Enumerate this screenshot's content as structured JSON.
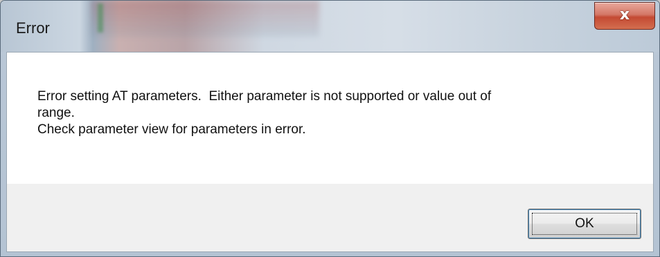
{
  "window": {
    "title": "Error",
    "close_label": "x"
  },
  "message": {
    "lines": [
      "Error setting AT parameters.  Either parameter is not supported or value out of",
      "range.",
      "Check parameter view for parameters in error."
    ]
  },
  "buttons": {
    "ok_label": "OK"
  }
}
